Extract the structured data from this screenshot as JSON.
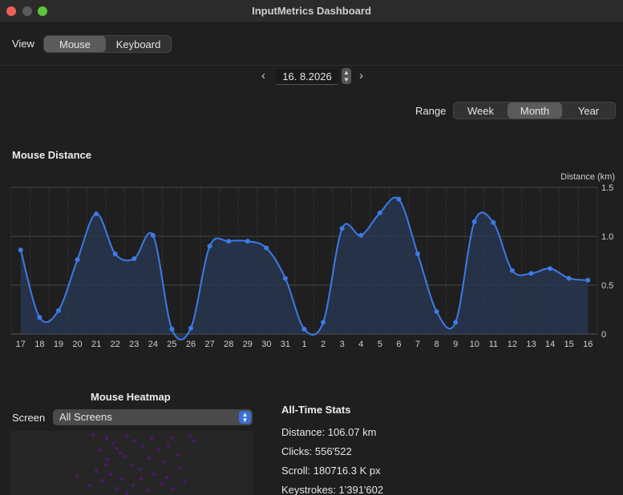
{
  "window": {
    "title": "InputMetrics Dashboard"
  },
  "view": {
    "label": "View",
    "options": [
      "Mouse",
      "Keyboard"
    ],
    "selected": "Mouse"
  },
  "date": {
    "value": "16.  8.2026"
  },
  "range": {
    "label": "Range",
    "options": [
      "Week",
      "Month",
      "Year"
    ],
    "selected": "Month"
  },
  "chart_section": {
    "title": "Mouse Distance"
  },
  "chart_data": {
    "type": "area",
    "title": "Mouse Distance",
    "ylabel": "Distance (km)",
    "ylim": [
      0,
      1.5
    ],
    "yticks": [
      "1.5",
      "1.0",
      "0.5",
      "0"
    ],
    "categories": [
      "17",
      "18",
      "19",
      "20",
      "21",
      "22",
      "23",
      "24",
      "25",
      "26",
      "27",
      "28",
      "29",
      "30",
      "31",
      "1",
      "2",
      "3",
      "4",
      "5",
      "6",
      "7",
      "8",
      "9",
      "10",
      "11",
      "12",
      "13",
      "14",
      "15",
      "16"
    ],
    "values": [
      0.86,
      0.17,
      0.24,
      0.76,
      1.23,
      0.82,
      0.77,
      1.01,
      0.05,
      0.06,
      0.9,
      0.95,
      0.95,
      0.88,
      0.57,
      0.05,
      0.12,
      1.08,
      1.01,
      1.24,
      1.38,
      0.82,
      0.23,
      0.12,
      1.15,
      1.14,
      0.65,
      0.62,
      0.67,
      0.57,
      0.55
    ],
    "grid": true,
    "colors": {
      "line": "#3d7ae8",
      "fill": "#2a3a55"
    }
  },
  "heatmap": {
    "title": "Mouse Heatmap",
    "screen_label": "Screen",
    "screen_value": "All Screens",
    "dot_color": "#4b1a6e"
  },
  "stats": {
    "title": "All-Time Stats",
    "distance": "Distance: 106.07 km",
    "clicks": "Clicks: 556'522",
    "scroll": "Scroll: 180716.3 K px",
    "keystrokes": "Keystrokes: 1'391'602"
  }
}
